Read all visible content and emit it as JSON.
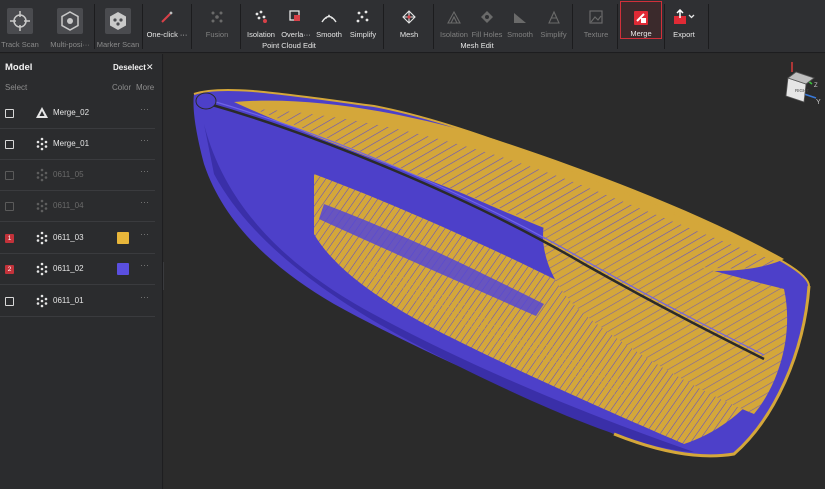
{
  "toolbar": {
    "scan_tools": [
      {
        "label": "Track Scan"
      },
      {
        "label": "Multi-posi···"
      },
      {
        "label": "Marker Scan"
      }
    ],
    "one_click": {
      "label": "One-click ···"
    },
    "point_cloud_edit": {
      "title": "Point Cloud Edit",
      "tools": [
        {
          "label": "Fusion"
        },
        {
          "label": "Isolation"
        },
        {
          "label": "Overla···"
        },
        {
          "label": "Smooth"
        },
        {
          "label": "Simplify"
        }
      ]
    },
    "mesh_edit": {
      "title": "Mesh Edit",
      "tools": [
        {
          "label": "Mesh"
        },
        {
          "label": "Isolation"
        },
        {
          "label": "Fill Holes"
        },
        {
          "label": "Smooth"
        },
        {
          "label": "Simplify"
        }
      ]
    },
    "texture": {
      "label": "Texture"
    },
    "merge": {
      "label": "Merge"
    },
    "export": {
      "label": "Export"
    }
  },
  "panel": {
    "title": "Model",
    "deselect": "Deselect",
    "close_glyph": "✕",
    "select": "Select",
    "color": "Color",
    "more": "More",
    "more_glyph": "···",
    "items": [
      {
        "name": "Merge_02",
        "badge": "",
        "swatch": ""
      },
      {
        "name": "Merge_01",
        "badge": "",
        "swatch": ""
      },
      {
        "name": "0611_05",
        "badge": "",
        "swatch": ""
      },
      {
        "name": "0611_04",
        "badge": "",
        "swatch": ""
      },
      {
        "name": "0611_03",
        "badge": "1",
        "swatch": "#e8b63a"
      },
      {
        "name": "0611_02",
        "badge": "2",
        "swatch": "#5a4fe0"
      },
      {
        "name": "0611_01",
        "badge": "",
        "swatch": ""
      }
    ]
  },
  "collapse_glyph": "‹",
  "axes": {
    "cube_label": "RIGHT",
    "y": "Y",
    "z": "Z"
  },
  "colors": {
    "yellow": "#d4a73a",
    "blue": "#5546d6",
    "accent": "#d0303a"
  }
}
